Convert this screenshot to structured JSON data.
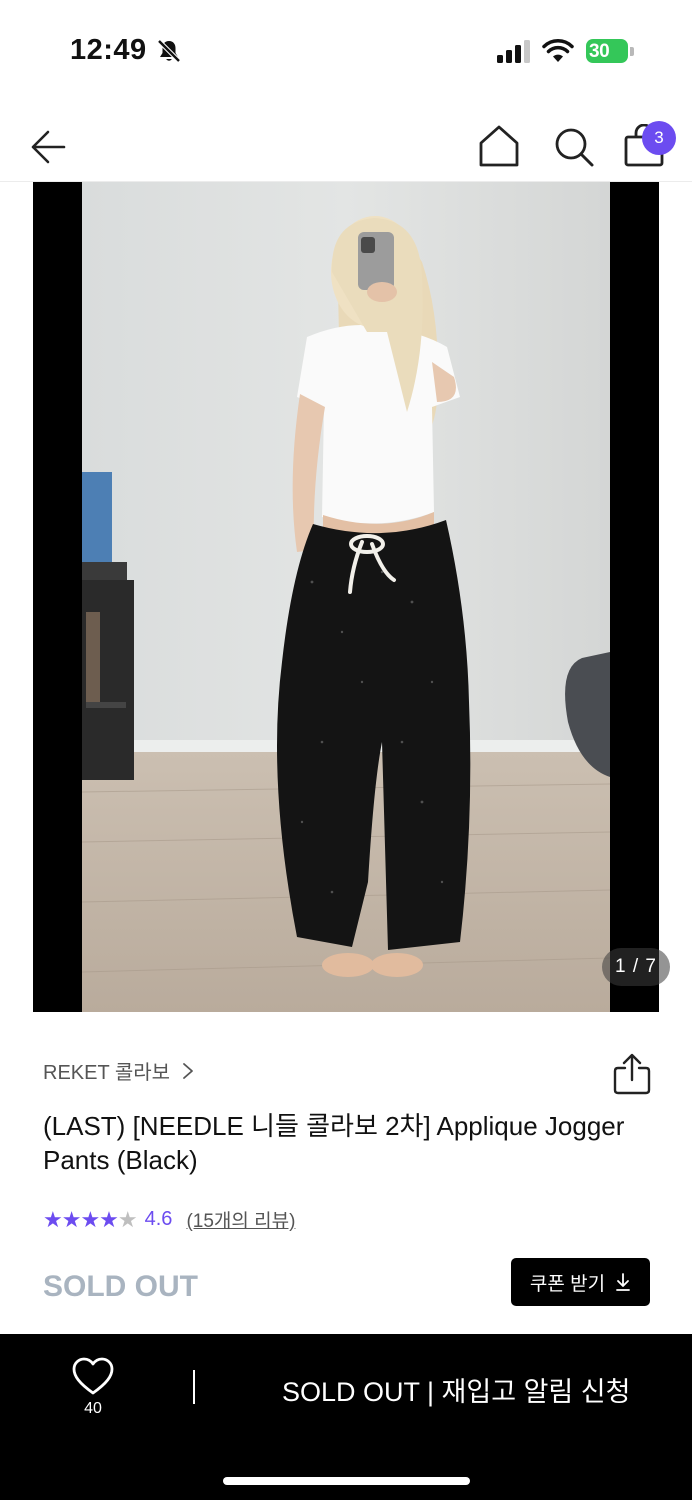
{
  "status_bar": {
    "time": "12:49",
    "battery": "30",
    "icons": [
      "bell-slash-icon",
      "cellular-signal-icon",
      "wifi-icon",
      "battery-charging-icon"
    ]
  },
  "nav": {
    "back_icon": "arrow-left-icon",
    "home_icon": "home-icon",
    "search_icon": "search-icon",
    "cart_icon": "shopping-bag-icon",
    "cart_count": "3",
    "accent_color": "#6c4cf0"
  },
  "gallery": {
    "counter": "1 / 7"
  },
  "product": {
    "brand": "REKET 콜라보",
    "title": "(LAST) [NEEDLE 니들 콜라보 2차] Applique Jogger Pants (Black)",
    "rating": {
      "stars_filled": 4,
      "stars_total": 5,
      "value": "4.6",
      "reviews": "(15개의 리뷰)"
    },
    "status": "SOLD OUT",
    "coupon_label": "쿠폰 받기",
    "share_icon": "share-icon"
  },
  "bottom_bar": {
    "like_icon": "heart-icon",
    "like_count": "40",
    "restock_label": "SOLD OUT | 재입고 알림 신청"
  }
}
